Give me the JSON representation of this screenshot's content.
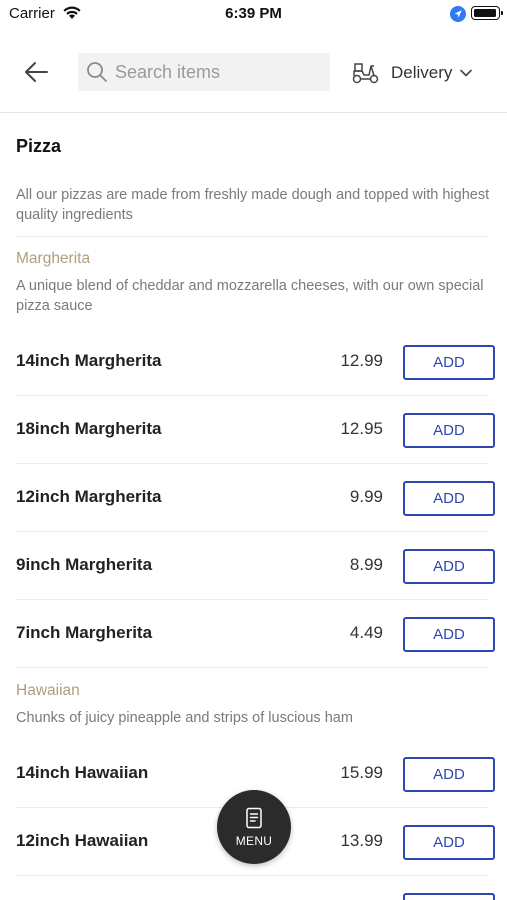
{
  "status_bar": {
    "carrier": "Carrier",
    "time": "6:39 PM"
  },
  "header": {
    "search_placeholder": "Search items",
    "delivery_label": "Delivery"
  },
  "section": {
    "title": "Pizza",
    "description": "All our pizzas are made from freshly made dough and topped with highest quality ingredients"
  },
  "groups": [
    {
      "title": "Margherita",
      "description": "A unique blend of cheddar and mozzarella cheeses, with our own special pizza sauce",
      "items": [
        {
          "name": "14inch Margherita",
          "price": "12.99",
          "add_label": "ADD"
        },
        {
          "name": "18inch Margherita",
          "price": "12.95",
          "add_label": "ADD"
        },
        {
          "name": "12inch Margherita",
          "price": "9.99",
          "add_label": "ADD"
        },
        {
          "name": "9inch Margherita",
          "price": "8.99",
          "add_label": "ADD"
        },
        {
          "name": "7inch Margherita",
          "price": "4.49",
          "add_label": "ADD"
        }
      ]
    },
    {
      "title": "Hawaiian",
      "description": "Chunks of juicy pineapple and strips of luscious ham",
      "items": [
        {
          "name": "14inch Hawaiian",
          "price": "15.99",
          "add_label": "ADD"
        },
        {
          "name": "12inch Hawaiian",
          "price": "13.99",
          "add_label": "ADD"
        }
      ]
    }
  ],
  "fab": {
    "label": "MENU"
  },
  "colors": {
    "accent": "#2c48b0",
    "subheading": "#b09f7e",
    "fab": "#2b2b2b"
  },
  "icons": [
    "wifi-icon",
    "location-arrow-icon",
    "battery-icon",
    "back-arrow-icon",
    "search-icon",
    "scooter-icon",
    "chevron-down-icon",
    "menu-book-icon"
  ]
}
